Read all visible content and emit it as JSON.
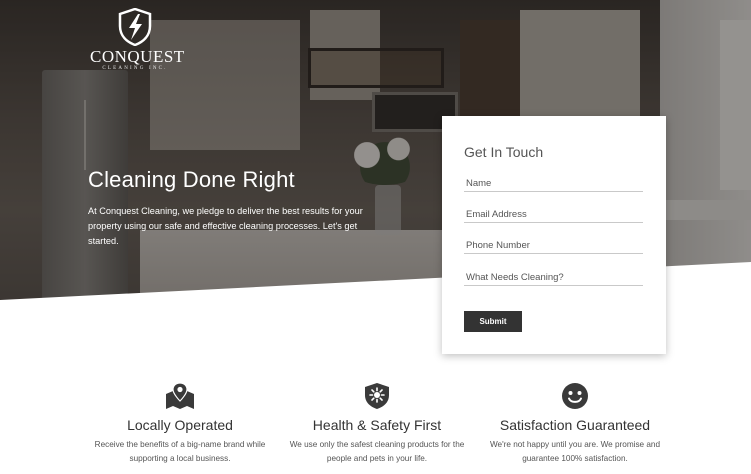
{
  "brand": {
    "name": "CONQUEST",
    "subtitle": "CLEANING INC."
  },
  "hero": {
    "title": "Cleaning Done Right",
    "text": "At Conquest Cleaning, we pledge to deliver the best results for your property using our safe and effective cleaning processes. Let's get started."
  },
  "contact_form": {
    "title": "Get In Touch",
    "name_placeholder": "Name",
    "email_placeholder": "Email Address",
    "phone_placeholder": "Phone Number",
    "needs_placeholder": "What Needs Cleaning?",
    "submit_label": "Submit"
  },
  "features": [
    {
      "icon": "map-pin-icon",
      "title": "Locally Operated",
      "text": "Receive the benefits of a big-name brand while supporting a local business."
    },
    {
      "icon": "shield-icon",
      "title": "Health & Safety First",
      "text": "We use only the safest cleaning products for the people and pets in your life."
    },
    {
      "icon": "smiley-icon",
      "title": "Satisfaction Guaranteed",
      "text": "We're not happy until you are. We promise and guarantee 100% satisfaction."
    }
  ],
  "colors": {
    "button_bg": "#333333",
    "text_dark": "#333333",
    "background": "#ffffff"
  }
}
